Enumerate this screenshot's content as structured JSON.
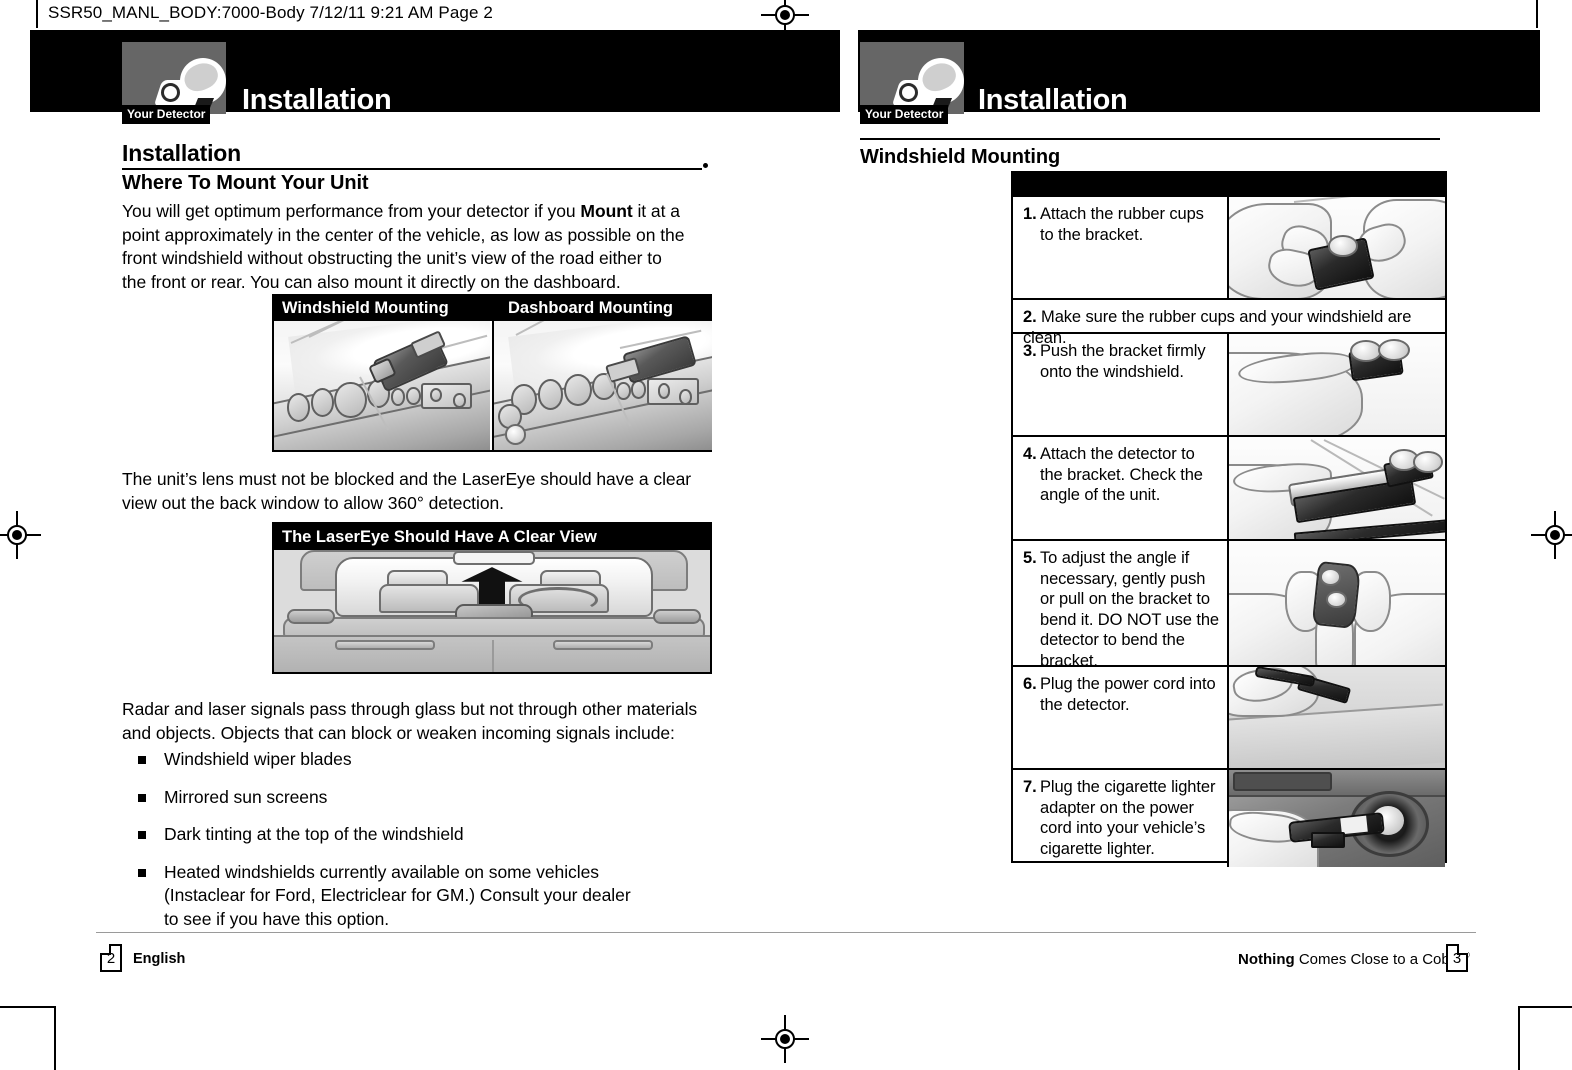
{
  "proof": {
    "slug": "SSR50_MANL_BODY:7000-Body  7/12/11  9:21 AM  Page 2"
  },
  "left_page": {
    "band_title": "Installation",
    "detector_tag": "Your Detector",
    "section_heading": "Installation",
    "subheading": "Where To Mount Your Unit",
    "intro_paragraph_1": "You will get optimum performance from your detector if you ",
    "intro_paragraph_bold": "Mount",
    "intro_paragraph_2": " it at a point approximately in the center of the vehicle, as low as possible on the front windshield without obstructing the unit’s view of the road either to the front or rear. You can also mount it directly on the dashboard.",
    "figure_mounting": {
      "caption_left": "Windshield Mounting",
      "caption_right": "Dashboard Mounting"
    },
    "lens_paragraph": "The unit’s lens must not be blocked and the LaserEye should have a clear view out the back window to allow 360° detection.",
    "figure_lasereye": {
      "caption": "The LaserEye Should Have A Clear View"
    },
    "signals_paragraph": "Radar and laser signals pass through glass but not through other materials and objects. Objects that can block or weaken incoming signals include:",
    "bullets": [
      "Windshield wiper blades",
      "Mirrored sun screens",
      "Dark tinting at the top of the windshield",
      "Heated windshields currently available on some vehicles (Instaclear for Ford, Electriclear for GM.) Consult your dealer to see if you have this option."
    ],
    "footer": {
      "page_number": "2",
      "label": "English"
    }
  },
  "right_page": {
    "band_title": "Installation",
    "detector_tag": "Your Detector",
    "section_heading": "Windshield Mounting",
    "steps": [
      {
        "number": "1.",
        "text": "Attach the rubber cups to the bracket.",
        "has_image": true
      },
      {
        "number": "2.",
        "text": "Make sure the rubber cups and your windshield are clean.",
        "has_image": false
      },
      {
        "number": "3.",
        "text": "Push the bracket firmly onto the windshield.",
        "has_image": true
      },
      {
        "number": "4.",
        "text": "Attach the detector to the bracket. Check the angle of the unit.",
        "has_image": true
      },
      {
        "number": "5.",
        "text": "To adjust the angle if necessary, gently push or pull on the bracket to bend it. DO NOT use the detector to bend the bracket.",
        "has_image": true
      },
      {
        "number": "6.",
        "text": "Plug the power cord into the detector.",
        "has_image": true
      },
      {
        "number": "7.",
        "text": "Plug the cigarette lighter adapter on the power cord into your vehicle’s cigarette lighter.",
        "has_image": true
      }
    ],
    "footer": {
      "page_number": "3",
      "tagline_bold": "Nothing",
      "tagline_rest": " Comes Close to a Cobra",
      "tagline_mark": "®"
    }
  },
  "colors": {
    "band": "#000000",
    "gray_box": "#666666",
    "paper": "#ffffff",
    "ink": "#000000"
  }
}
